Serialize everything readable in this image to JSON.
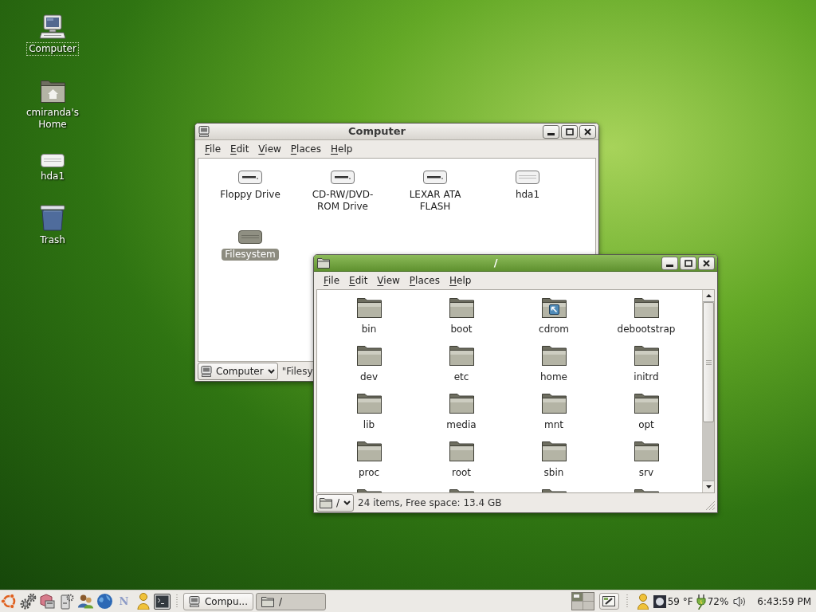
{
  "desktop": {
    "icons": [
      {
        "kind": "computer",
        "label": "Computer",
        "focused": true
      },
      {
        "kind": "home",
        "label": "cmiranda's Home",
        "focused": false
      },
      {
        "kind": "drive",
        "label": "hda1",
        "focused": false
      },
      {
        "kind": "trash",
        "label": "Trash",
        "focused": false
      }
    ]
  },
  "windows": [
    {
      "kind": "computer",
      "title": "Computer",
      "active": false,
      "menu": [
        "File",
        "Edit",
        "View",
        "Places",
        "Help"
      ],
      "items": [
        {
          "kind": "removable",
          "label": "Floppy Drive",
          "selected": false
        },
        {
          "kind": "removable",
          "label": "CD-RW/DVD-ROM Drive",
          "selected": false
        },
        {
          "kind": "removable",
          "label": "LEXAR ATA FLASH",
          "selected": false
        },
        {
          "kind": "harddisk",
          "label": "hda1",
          "selected": false
        },
        {
          "kind": "filesystem",
          "label": "Filesystem",
          "selected": true
        }
      ],
      "location": {
        "kind": "computer",
        "label": "Computer"
      },
      "status": "\"Filesy"
    },
    {
      "kind": "folder",
      "title": "/",
      "active": true,
      "scrollbar": true,
      "menu": [
        "File",
        "Edit",
        "View",
        "Places",
        "Help"
      ],
      "items": [
        {
          "kind": "folder",
          "label": "bin",
          "selected": false
        },
        {
          "kind": "folder",
          "label": "boot",
          "selected": false
        },
        {
          "kind": "folder-link",
          "label": "cdrom",
          "selected": false
        },
        {
          "kind": "folder",
          "label": "debootstrap",
          "selected": false
        },
        {
          "kind": "folder",
          "label": "dev",
          "selected": false
        },
        {
          "kind": "folder",
          "label": "etc",
          "selected": false
        },
        {
          "kind": "folder",
          "label": "home",
          "selected": false
        },
        {
          "kind": "folder",
          "label": "initrd",
          "selected": false
        },
        {
          "kind": "folder",
          "label": "lib",
          "selected": false
        },
        {
          "kind": "folder",
          "label": "media",
          "selected": false
        },
        {
          "kind": "folder",
          "label": "mnt",
          "selected": false
        },
        {
          "kind": "folder",
          "label": "opt",
          "selected": false
        },
        {
          "kind": "folder",
          "label": "proc",
          "selected": false
        },
        {
          "kind": "folder",
          "label": "root",
          "selected": false
        },
        {
          "kind": "folder",
          "label": "sbin",
          "selected": false
        },
        {
          "kind": "folder",
          "label": "srv",
          "selected": false
        },
        {
          "kind": "folder",
          "selected": false
        },
        {
          "kind": "folder",
          "selected": false
        },
        {
          "kind": "folder",
          "selected": false
        },
        {
          "kind": "folder",
          "selected": false
        }
      ],
      "location": {
        "kind": "folder",
        "label": "/"
      },
      "status": "24 items, Free space: 13.4 GB"
    }
  ],
  "taskbar": {
    "launchers": [
      {
        "kind": "ubuntu"
      },
      {
        "kind": "gears"
      },
      {
        "kind": "boxes"
      },
      {
        "kind": "gear-panel"
      },
      {
        "kind": "users"
      },
      {
        "kind": "globe"
      },
      {
        "kind": "letter",
        "glyph": "N"
      },
      {
        "kind": "person"
      },
      {
        "kind": "terminal"
      }
    ],
    "tasks": [
      {
        "kind": "computer",
        "label": "Compu...",
        "selected": false
      },
      {
        "kind": "folder",
        "label": "/",
        "selected": true
      }
    ],
    "workspaces": [
      {
        "selected": true
      },
      {
        "selected": false
      },
      {
        "selected": false
      },
      {
        "selected": false
      }
    ],
    "weather": {
      "reading": "59 °F"
    },
    "battery": {
      "reading": "72%"
    },
    "clock": "6:43:59 PM"
  }
}
